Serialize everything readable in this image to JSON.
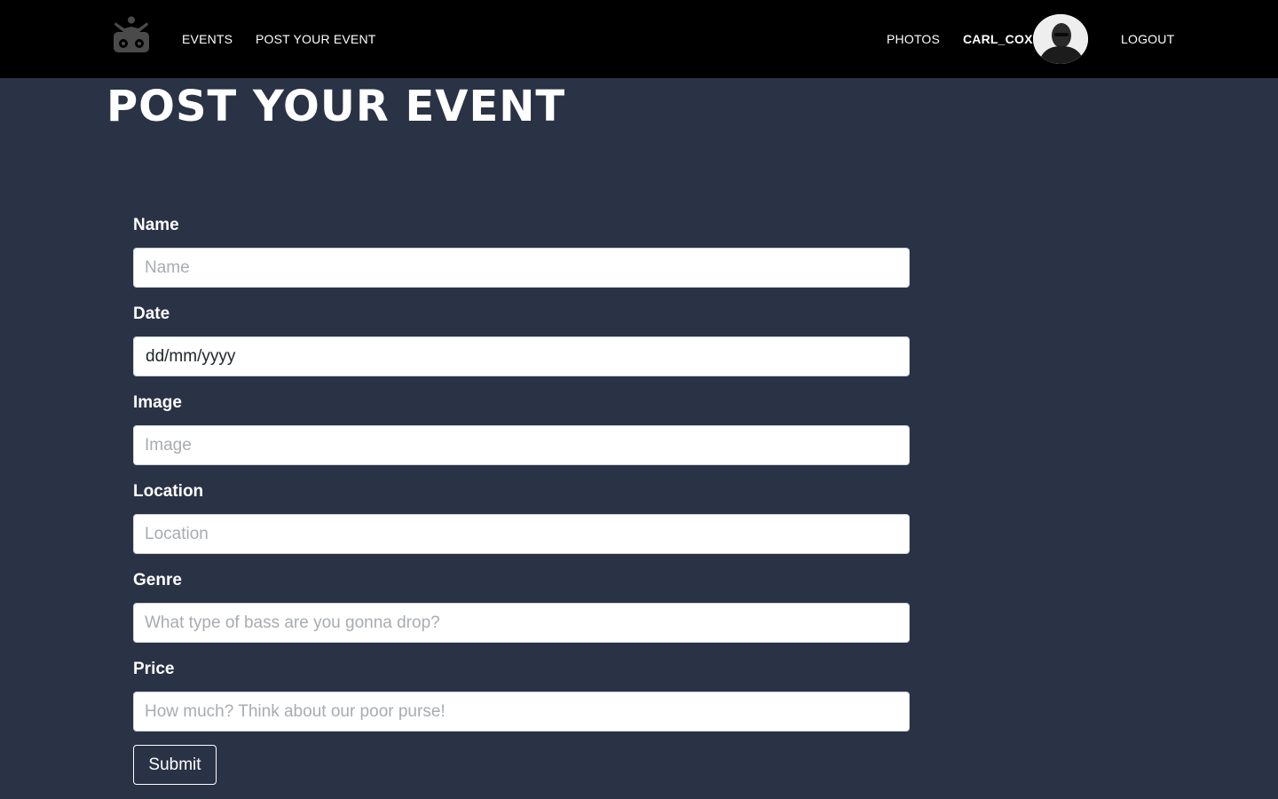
{
  "nav": {
    "logo_icon": "dj-boombox-icon",
    "events_label": "EVENTS",
    "post_label": "POST YOUR EVENT",
    "photos_label": "PHOTOS",
    "username": "CARL_COX",
    "logout_label": "LOGOUT",
    "avatar_icon": "user-avatar-photo"
  },
  "page": {
    "title": "POST YOUR EVENT"
  },
  "form": {
    "name": {
      "label": "Name",
      "placeholder": "Name"
    },
    "date": {
      "label": "Date",
      "value": "dd/mm/yyyy"
    },
    "image": {
      "label": "Image",
      "placeholder": "Image"
    },
    "location": {
      "label": "Location",
      "placeholder": "Location"
    },
    "genre": {
      "label": "Genre",
      "placeholder": "What type of bass are you gonna drop?"
    },
    "price": {
      "label": "Price",
      "placeholder": "How much? Think about our poor purse!"
    },
    "submit_label": "Submit"
  },
  "colors": {
    "background": "#2a3245",
    "navbar": "#000000",
    "text": "#ffffff"
  }
}
